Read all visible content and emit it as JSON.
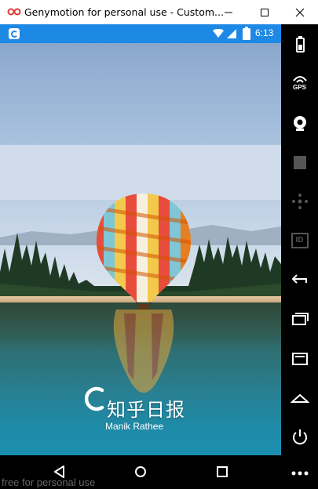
{
  "window": {
    "title": "Genymotion for personal use - Custom...",
    "minimize_label": "",
    "maximize_label": "",
    "close_label": ""
  },
  "status_bar": {
    "time": "6:13",
    "app_icon": "app-icon",
    "wifi_icon": "wifi-icon",
    "signal_icon": "signal-icon",
    "battery_icon": "battery-icon"
  },
  "splash": {
    "app_name": "知乎日报",
    "author": "Manik Rathee",
    "background": "hot-air-balloon-over-lake-photo"
  },
  "navbar": {
    "back_icon": "back-icon",
    "home_icon": "home-icon",
    "recent_icon": "recent-apps-icon"
  },
  "side_toolbar": {
    "gps_label": "GPS",
    "id_label": "ID",
    "items": [
      "battery-icon",
      "gps-icon",
      "camera-icon",
      "media-icon",
      "dpad-icon",
      "id-icon",
      "back-icon",
      "recent-apps-icon",
      "menu-icon",
      "home-icon",
      "power-icon",
      "more-icon"
    ]
  },
  "watermark": "free for personal use",
  "colors": {
    "status_bar": "#1e88e5",
    "nav_bar": "#000000",
    "toolbar": "#000000"
  }
}
